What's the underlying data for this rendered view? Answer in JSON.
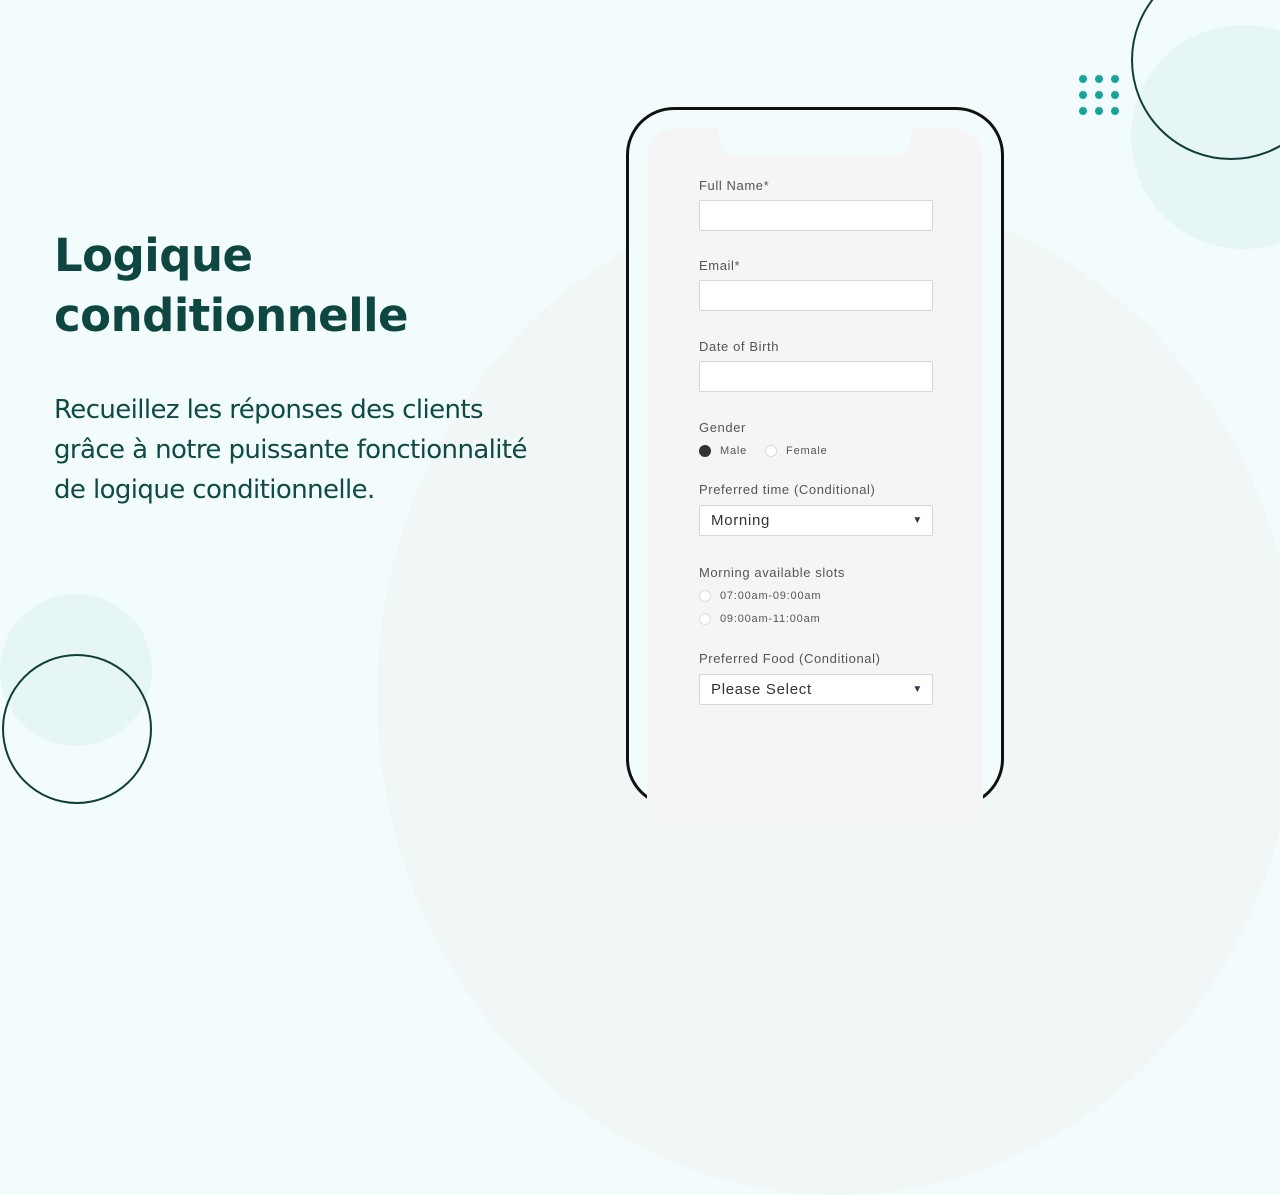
{
  "hero": {
    "title_line1": "Logique",
    "title_line2": "conditionnelle",
    "description_line1": "Recueillez les réponses des clients",
    "description_line2": "grâce à notre puissante fonctionnalité",
    "description_line3": "de logique conditionnelle."
  },
  "colors": {
    "brand_dark": "#0e4641",
    "accent_teal": "#14a69c",
    "background": "#f2fcfc"
  },
  "form": {
    "full_name": {
      "label": "Full Name*",
      "value": ""
    },
    "email": {
      "label": "Email*",
      "value": ""
    },
    "dob": {
      "label": "Date of Birth",
      "value": ""
    },
    "gender": {
      "label": "Gender",
      "options": [
        {
          "label": "Male",
          "checked": true
        },
        {
          "label": "Female",
          "checked": false
        }
      ]
    },
    "preferred_time": {
      "label": "Preferred time (Conditional)",
      "value": "Morning"
    },
    "morning_slots": {
      "label": "Morning available slots",
      "options": [
        {
          "label": "07:00am-09:00am",
          "checked": false
        },
        {
          "label": "09:00am-11:00am",
          "checked": false
        }
      ]
    },
    "preferred_food": {
      "label": "Preferred Food (Conditional)",
      "value": "Please Select"
    }
  }
}
